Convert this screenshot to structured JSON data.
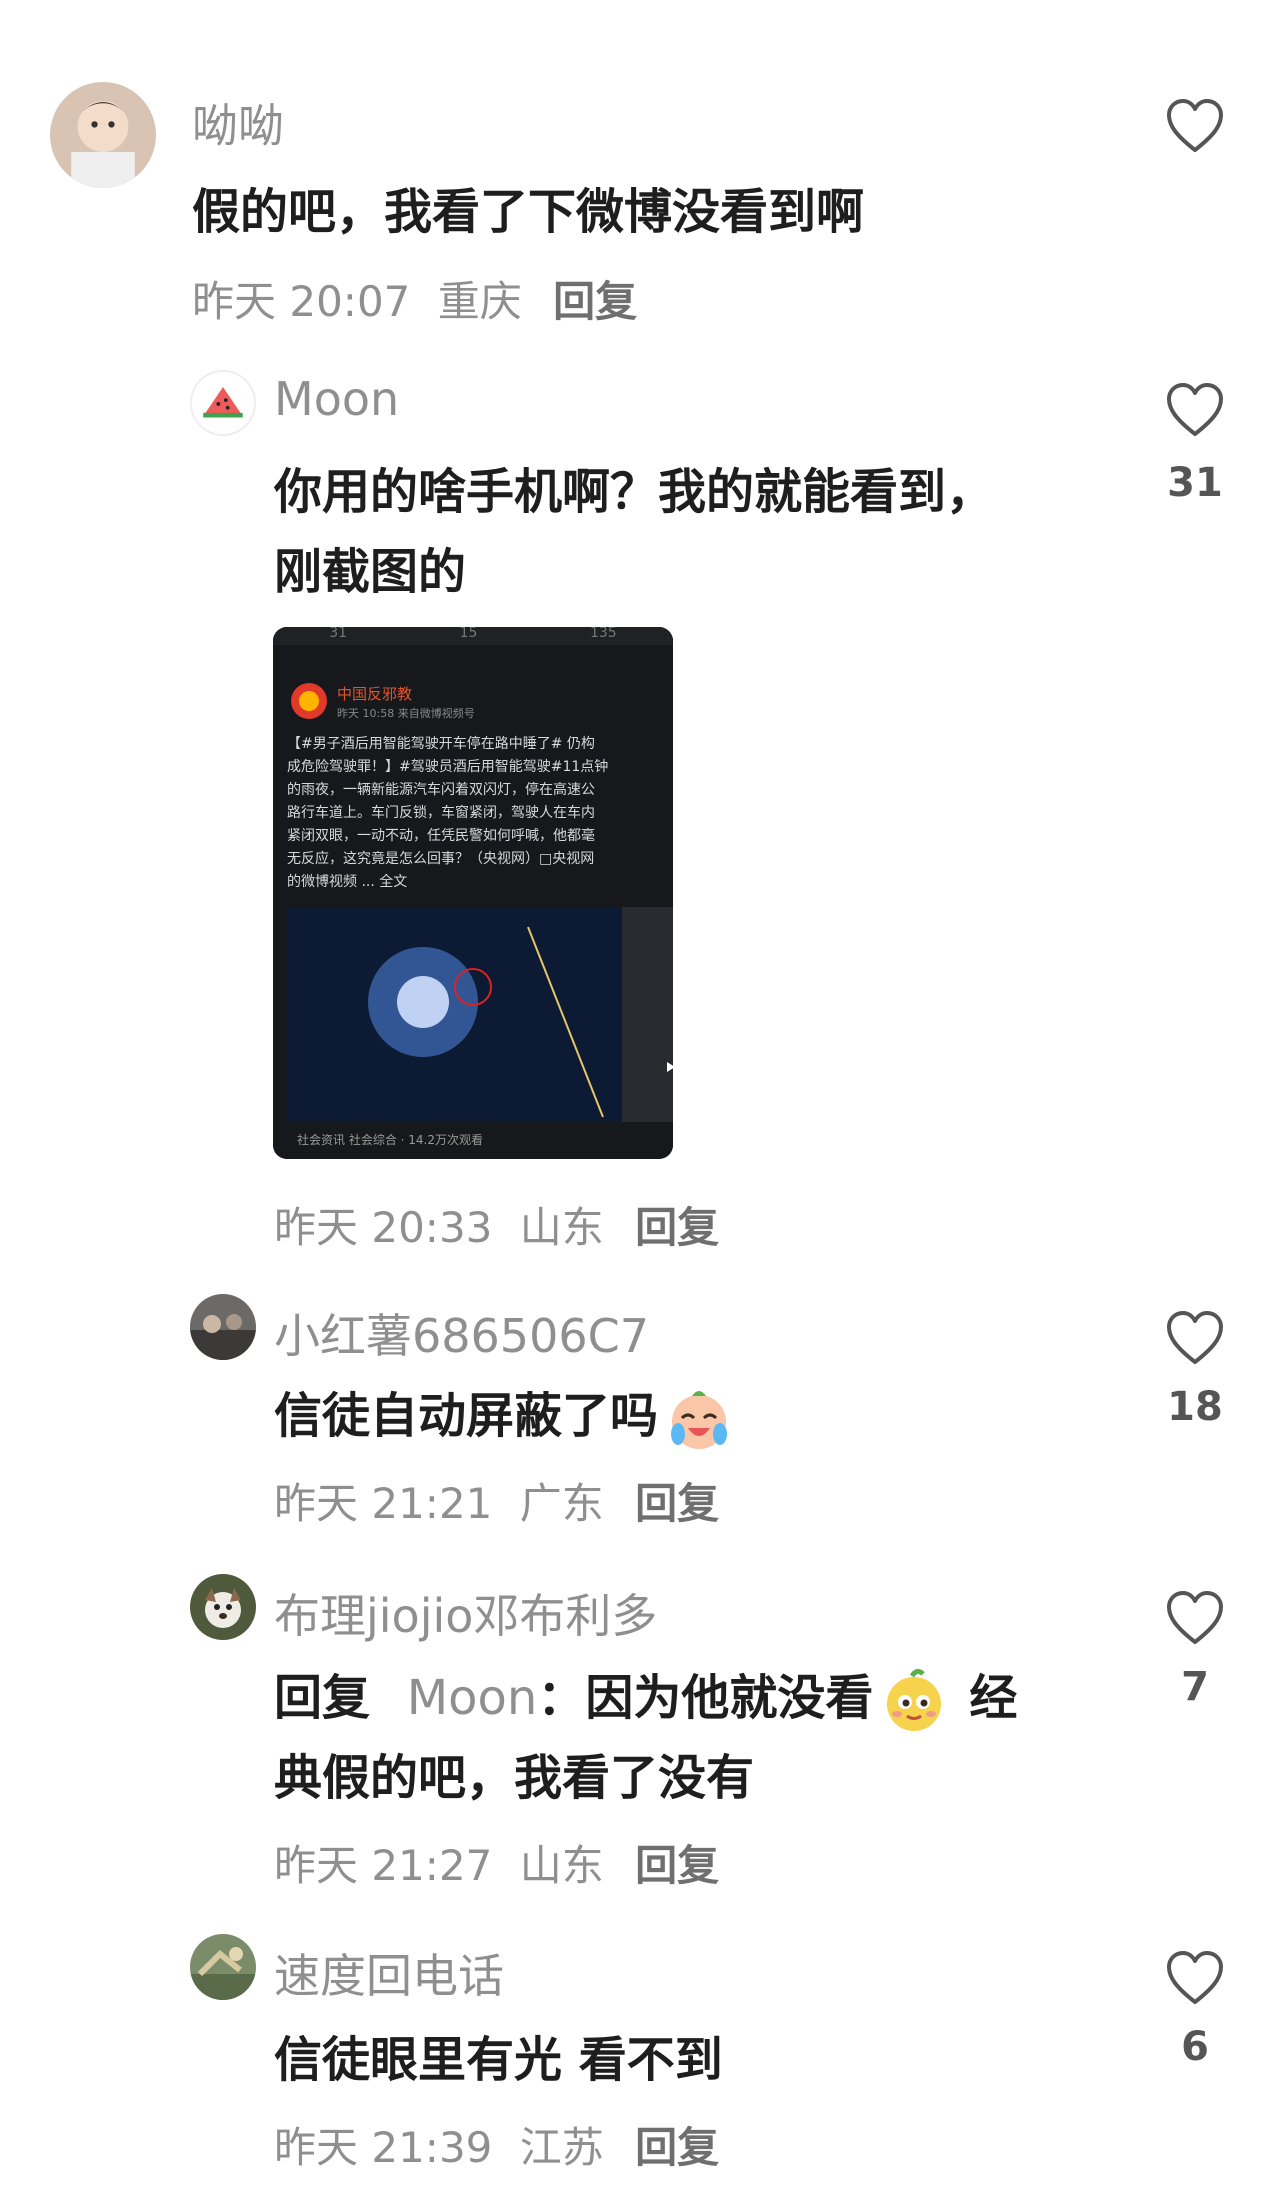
{
  "comments": [
    {
      "username": "呦呦",
      "text": "假的吧，我看了下微博没看到啊",
      "time": "昨天 20:07",
      "location": "重庆",
      "reply_label": "回复",
      "likes": ""
    },
    {
      "username": "Moon",
      "text_line1": "你用的啥手机啊？我的就能看到，",
      "text_line2": "刚截图的",
      "time": "昨天 20:33",
      "location": "山东",
      "reply_label": "回复",
      "likes": "31",
      "screenshot": {
        "top_counts": [
          "31",
          "15",
          "135"
        ],
        "account": "中国反邪教",
        "post_meta": "昨天 10:58  来自微博视频号",
        "post_text_lines": [
          "【#男子酒后用智能驾驶开车停在路中睡了# 仍构",
          "成危险驾驶罪！】#驾驶员酒后用智能驾驶#11点钟",
          "的雨夜，一辆新能源汽车闪着双闪灯，停在高速公",
          "路行车道上。车门反锁，车窗紧闭，驾驶人在车内",
          "紧闭双眼，一动不动，任凭民警如何呼喊，他都毫",
          "无反应，这究竟是怎么回事？（央视网）□央视网",
          "的微博视频 ... 全文"
        ],
        "video_footer": "社会资讯 社会综合 · 14.2万次观看"
      }
    },
    {
      "username": "小红薯686506C7",
      "text": "信徒自动屏蔽了吗",
      "time": "昨天 21:21",
      "location": "广东",
      "reply_label": "回复",
      "likes": "18"
    },
    {
      "username": "布理jiojio邓布利多",
      "reply_prefix": "回复",
      "mention": "Moon",
      "text_a": "：因为他就没看",
      "text_b": "经",
      "text_line2": "典假的吧，我看了没有",
      "time": "昨天 21:27",
      "location": "山东",
      "reply_label": "回复",
      "likes": "7"
    },
    {
      "username": "速度回电话",
      "text": "信徒眼里有光 看不到",
      "time": "昨天 21:39",
      "location": "江苏",
      "reply_label": "回复",
      "likes": "6"
    }
  ],
  "icons": {
    "like": "heart-outline-icon",
    "emoji_cry": "crying-laughing-emoji",
    "emoji_smirk": "smirk-emoji"
  },
  "colors": {
    "username": "#8f8f8f",
    "text": "#1e1e1e",
    "meta": "#8f8f8f",
    "like_outline": "#555555"
  }
}
